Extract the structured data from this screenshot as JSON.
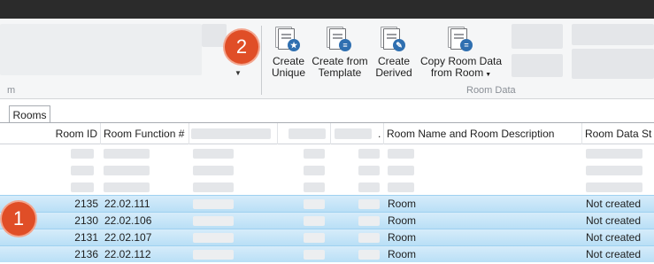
{
  "ribbon": {
    "group_left_label_fragment": "m",
    "group_room_data_label": "Room Data",
    "buttons": [
      {
        "line1": "Create",
        "line2": "Unique",
        "icon": "star-badge-icon",
        "badge_color": "#2f6fb0"
      },
      {
        "line1": "Create from",
        "line2": "Template",
        "icon": "list-badge-icon",
        "badge_color": "#2f6fb0"
      },
      {
        "line1": "Create",
        "line2": "Derived",
        "icon": "pen-badge-icon",
        "badge_color": "#2f6fb0"
      },
      {
        "line1": "Copy Room Data",
        "line2": "from Room",
        "icon": "copy-badge-icon",
        "badge_color": "#2f6fb0"
      }
    ]
  },
  "callouts": {
    "ribbon_callout": "2",
    "rows_callout": "1",
    "color": "#e04e27"
  },
  "tabs": {
    "active": "Rooms"
  },
  "grid": {
    "headers": {
      "room_id": "Room ID",
      "room_function": "Room Function #",
      "ellipsis": ".",
      "room_name": "Room Name and Room Description",
      "room_data_status": "Room Data St"
    },
    "selected_color": "#b9dff6",
    "rows": [
      {
        "room_id": "2135",
        "room_function": "22.02.111",
        "room_name": "Room",
        "status": "Not created"
      },
      {
        "room_id": "2130",
        "room_function": "22.02.106",
        "room_name": "Room",
        "status": "Not created"
      },
      {
        "room_id": "2131",
        "room_function": "22.02.107",
        "room_name": "Room",
        "status": "Not created"
      },
      {
        "room_id": "2136",
        "room_function": "22.02.112",
        "room_name": "Room",
        "status": "Not created"
      }
    ]
  }
}
